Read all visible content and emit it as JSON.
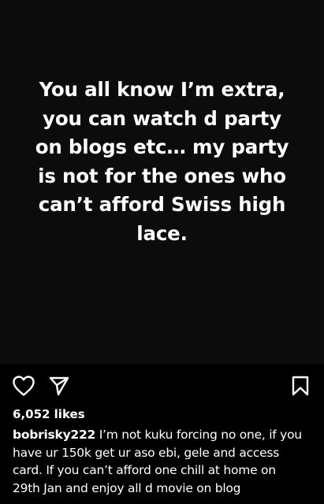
{
  "post": {
    "story_lines": [
      "You all know I’m extra,",
      "you can watch d party",
      "on blogs etc… my party",
      "is not for the ones who",
      "can’t afford Swiss high",
      "lace."
    ]
  },
  "actions": {
    "like_icon": "heart-outline-icon",
    "share_icon": "paper-plane-icon",
    "save_icon": "bookmark-outline-icon"
  },
  "likes": "6,052 likes",
  "caption": {
    "username": "bobrisky222",
    "first_line": " I’m not kuku forcing no one, if you",
    "lines": [
      "have ur 150k get ur aso ebi, gele and access",
      "card. If you can’t afford one chill at home on",
      "29th Jan and enjoy all d movie on blog"
    ]
  }
}
